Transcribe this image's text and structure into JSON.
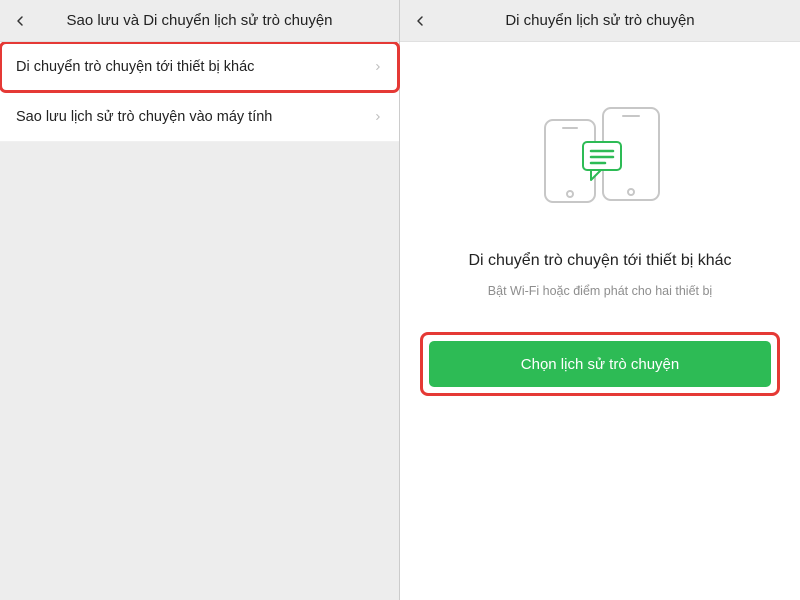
{
  "left": {
    "header_title": "Sao lưu và Di chuyển lịch sử trò chuyện",
    "rows": [
      {
        "label": "Di chuyển trò chuyện tới thiết bị khác"
      },
      {
        "label": "Sao lưu lịch sử trò chuyện vào máy tính"
      }
    ]
  },
  "right": {
    "header_title": "Di chuyển lịch sử trò chuyện",
    "title": "Di chuyển trò chuyện tới thiết bị khác",
    "subtitle": "Bật Wi-Fi hoặc điểm phát cho hai thiết bị",
    "button_label": "Chọn lịch sử trò chuyện"
  },
  "colors": {
    "accent": "#2dbb55",
    "highlight": "#e53935"
  }
}
